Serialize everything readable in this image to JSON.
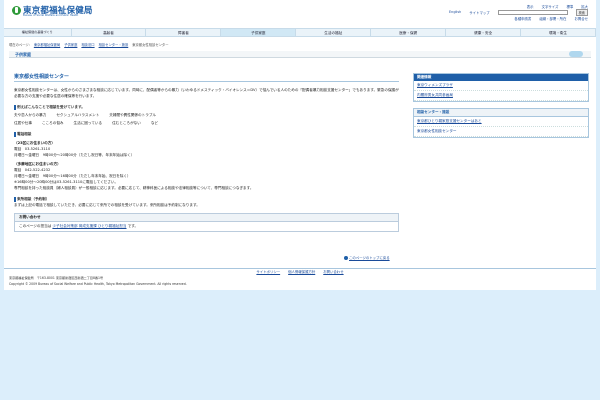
{
  "header": {
    "logo_text": "東京都福祉保健局",
    "logo_sub": "Bureau of Social Welfare and Public Health",
    "util_links": [
      "表示",
      "文字サイズ",
      "標準",
      "拡大"
    ],
    "lang_links": [
      "English",
      "サイトマップ"
    ],
    "sub_links": [
      "各種申請書",
      "組織・部署・所在",
      "お問合せ"
    ],
    "search_button": "検索"
  },
  "nav": {
    "items": [
      "福祉保健の基盤づくり",
      "高齢者",
      "障害者",
      "子供家庭",
      "生活の福祉",
      "医療・保健",
      "健康・安全",
      "環境・衛生"
    ]
  },
  "breadcrumb": [
    "現在のページ:",
    "東京都福祉保健局",
    "子供家庭",
    "相談窓口",
    "相談センター・施設",
    "東京都女性相談センター"
  ],
  "section": {
    "title": "子供家庭"
  },
  "main": {
    "title": "東京都女性相談センター",
    "intro": "東京都女性相談センターは、女性からのさまざまな相談に応じています。同時に、配偶者等からの暴力（いわゆるドメスティック・バイオレンス＝DV）で悩んでいる人のための「配偶者暴力相談支援センター」でもあります。緊急の保護が必要な方の支援や必要な住居の確保等を行います。",
    "kinds_heading": "例えばこんなことで相談を受けています。",
    "kinds_row1": [
      "夫や恋人からの暴力",
      "セクシュアルハラスメント",
      "夫婦間や異性関係のトラブル"
    ],
    "kinds_row2": [
      "住居や仕事",
      "こころの悩み",
      "生活に困っている",
      "住むところがない",
      "など"
    ],
    "phone_heading": "電話相談",
    "center1_title": "（23区にお住まいの方）",
    "center1_phone": "電話　03-5261-3110",
    "center1_hours": "月曜日～金曜日　9時00分～20時00分（ただし祝日等、年末年始は除く）",
    "center2_title": "（多摩地区にお住まいの方）",
    "center2_phone": "電話　042-522-4232",
    "center2_hours": "月曜日～金曜日　9時00分～16時00分（ただし年末年始、祝日を除く）",
    "center2_note": "※16時00分～20時00分は03-5261-3110に電話してください。",
    "expert_note": "専門相談を持った相談員（婦人相談員）が一般相談に応じます。必要に応じて、精神科医による相談や法律相談等について、専門相談につなぎます。",
    "visit_heading": "来所相談（予約制）",
    "visit_text": "まずは上記の電話で相談していただき、必要に応じて来所での相談を受けています。来所相談は予約制になります。",
    "inquiry_heading": "お問い合わせ",
    "inquiry_prefix": "このページの担当は",
    "inquiry_link": "少子社会対策部 育成支援課 ひとり親福祉担当",
    "inquiry_suffix": "です。",
    "to_top": "このページのトップに戻る"
  },
  "side": {
    "related_heading": "関連情報",
    "related_items": [
      "東京ウィメンズプラザ",
      "内閣府男女共同参画局"
    ],
    "center_heading": "相談センター・施設",
    "center_items": [
      "東京都ひとり親家庭支援センターはあと",
      "東京都女性相談センター"
    ]
  },
  "footer": {
    "links": [
      "サイトポリシー",
      "個人情報保護方針",
      "お問い合わせ"
    ],
    "org": "東京都福祉保健局",
    "address": "〒163-8001 東京都新宿区西新宿二丁目8番1号",
    "copyright": "Copyright © 2009 Bureau of Social Welfare and Public Health, Tokyo Metropolitan Government. All rights reserved."
  },
  "colors": {
    "brand": "#1f5fa8",
    "nav_bg": "#eaf3f9",
    "logo_green": "#2f9a3a",
    "outer_bg": "#dceefb"
  }
}
